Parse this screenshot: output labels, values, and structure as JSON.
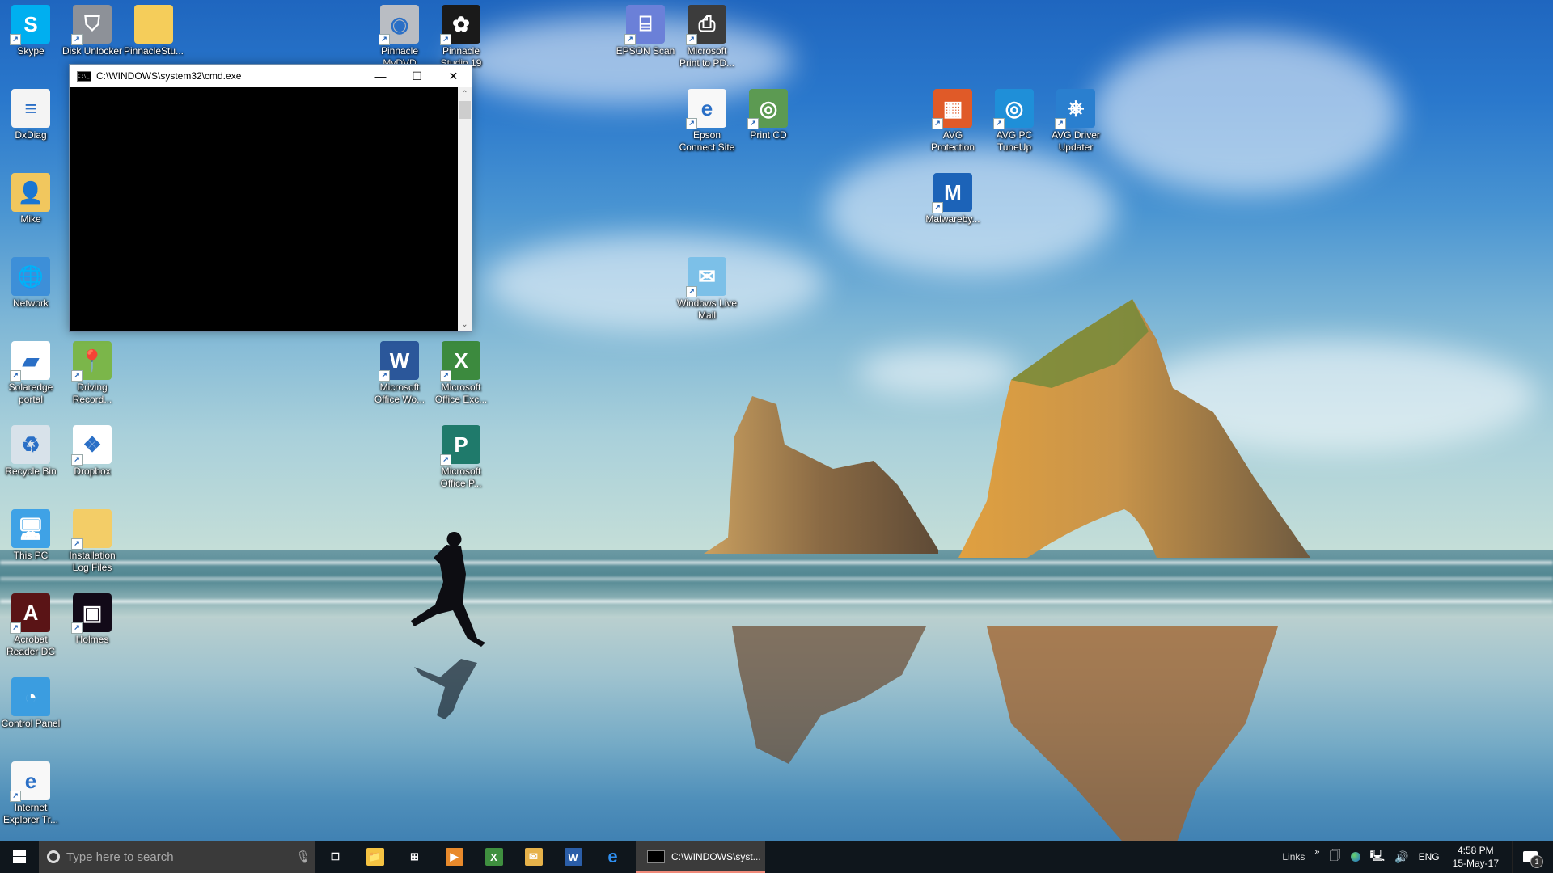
{
  "desktop": {
    "icons": [
      {
        "id": "skype",
        "label": "Skype",
        "glyph": "S",
        "color": "#00aff0",
        "shortcut": true
      },
      {
        "id": "disk-unlocker",
        "label": "Disk Unlocker",
        "glyph": "⛉",
        "color": "#8d9198",
        "shortcut": true
      },
      {
        "id": "pinnaclestudio-folder",
        "label": "PinnacleStu...",
        "glyph": "",
        "color": "#f5cd5a",
        "shortcut": false
      },
      {
        "id": "pinnacle-mydvd",
        "label": "Pinnacle MyDVD",
        "glyph": "◉",
        "color": "#b9bdc3",
        "shortcut": true
      },
      {
        "id": "pinnacle-studio-19",
        "label": "Pinnacle Studio 19",
        "glyph": "✿",
        "color": "#1a1a1a",
        "shortcut": true
      },
      {
        "id": "dxdiag",
        "label": "DxDiag",
        "glyph": "≡",
        "color": "#f4f4f4",
        "shortcut": false
      },
      {
        "id": "mike",
        "label": "Mike",
        "glyph": "👤",
        "color": "#f1c75e",
        "shortcut": false
      },
      {
        "id": "network",
        "label": "Network",
        "glyph": "🌐",
        "color": "#3d8fd8",
        "shortcut": false
      },
      {
        "id": "solaredge-portal",
        "label": "Solaredge portal",
        "glyph": "▰",
        "color": "#ffffff",
        "shortcut": true
      },
      {
        "id": "driving-record",
        "label": "Driving Record...",
        "glyph": "📍",
        "color": "#7bb64a",
        "shortcut": true
      },
      {
        "id": "recycle-bin",
        "label": "Recycle Bin",
        "glyph": "♻",
        "color": "#d8e2ea",
        "shortcut": false
      },
      {
        "id": "dropbox",
        "label": "Dropbox",
        "glyph": "❖",
        "color": "#ffffff",
        "shortcut": true
      },
      {
        "id": "this-pc",
        "label": "This PC",
        "glyph": "🖥",
        "color": "#3fa2e6",
        "shortcut": false
      },
      {
        "id": "installation-log-files",
        "label": "Installation Log Files",
        "glyph": "",
        "color": "#f3cd67",
        "shortcut": true
      },
      {
        "id": "acrobat-reader-dc",
        "label": "Acrobat Reader DC",
        "glyph": "A",
        "color": "#5a1416",
        "shortcut": true
      },
      {
        "id": "holmes",
        "label": "Holmes",
        "glyph": "▣",
        "color": "#120a18",
        "shortcut": true
      },
      {
        "id": "control-panel",
        "label": "Control Panel",
        "glyph": "◔",
        "color": "#3b9de0",
        "shortcut": false
      },
      {
        "id": "internet-explorer-tr",
        "label": "Internet Explorer Tr...",
        "glyph": "e",
        "color": "#f8f8f8",
        "shortcut": true
      },
      {
        "id": "microsoft-office-word",
        "label": "Microsoft Office Wo...",
        "glyph": "W",
        "color": "#2b579a",
        "shortcut": true
      },
      {
        "id": "microsoft-office-excel",
        "label": "Microsoft Office Exc...",
        "glyph": "X",
        "color": "#3c8a3e",
        "shortcut": true
      },
      {
        "id": "microsoft-office-publisher",
        "label": "Microsoft Office P...",
        "glyph": "P",
        "color": "#1f7a6b",
        "shortcut": true
      },
      {
        "id": "epson-scan",
        "label": "EPSON Scan",
        "glyph": "⌸",
        "color": "#6b80d8",
        "shortcut": true
      },
      {
        "id": "microsoft-print-to-pdf",
        "label": "Microsoft Print to PD...",
        "glyph": "⎙",
        "color": "#3c3c3c",
        "shortcut": true
      },
      {
        "id": "epson-connect-site",
        "label": "Epson Connect Site",
        "glyph": "e",
        "color": "#f8f8f8",
        "shortcut": true
      },
      {
        "id": "print-cd",
        "label": "Print CD",
        "glyph": "◎",
        "color": "#5c9a52",
        "shortcut": true
      },
      {
        "id": "windows-live-mail",
        "label": "Windows Live Mail",
        "glyph": "✉",
        "color": "#7cc0e8",
        "shortcut": true
      },
      {
        "id": "avg-protection",
        "label": "AVG Protection",
        "glyph": "▦",
        "color": "#e05a28",
        "shortcut": true
      },
      {
        "id": "avg-pc-tuneup",
        "label": "AVG PC TuneUp",
        "glyph": "◎",
        "color": "#1f8fd8",
        "shortcut": true
      },
      {
        "id": "avg-driver-updater",
        "label": "AVG Driver Updater",
        "glyph": "⎈",
        "color": "#2a7fcf",
        "shortcut": true
      },
      {
        "id": "malwarebytes",
        "label": "Malwareby...",
        "glyph": "M",
        "color": "#1c63b8",
        "shortcut": true
      }
    ]
  },
  "cmd_window": {
    "title": "C:\\WINDOWS\\system32\\cmd.exe",
    "icon_text": "C:\\_",
    "minimize": "—",
    "maximize": "☐",
    "close": "✕",
    "scroll_up": "⌃",
    "scroll_down": "⌄"
  },
  "taskbar": {
    "search_placeholder": "Type here to search",
    "pinned": [
      {
        "id": "task-view",
        "glyph": "⧠",
        "color": "transparent"
      },
      {
        "id": "file-explorer",
        "glyph": "📁",
        "color": "#f5c342"
      },
      {
        "id": "store",
        "glyph": "⊞",
        "color": "transparent"
      },
      {
        "id": "media-player",
        "glyph": "▶",
        "color": "#e88a2c"
      },
      {
        "id": "excel",
        "glyph": "X",
        "color": "#3f8f3f"
      },
      {
        "id": "windows-live-mail",
        "glyph": "✉",
        "color": "#e6b24a"
      },
      {
        "id": "word",
        "glyph": "W",
        "color": "#2b5ea8"
      },
      {
        "id": "edge",
        "glyph": "e",
        "color": "transparent"
      }
    ],
    "active_task": {
      "label": "C:\\WINDOWS\\syst...",
      "accent": "#f08a7a"
    },
    "tray": {
      "links_label": "Links",
      "overflow": "»",
      "language": "ENG",
      "time": "4:58 PM",
      "date": "15-May-17",
      "notification_count": "1"
    }
  }
}
